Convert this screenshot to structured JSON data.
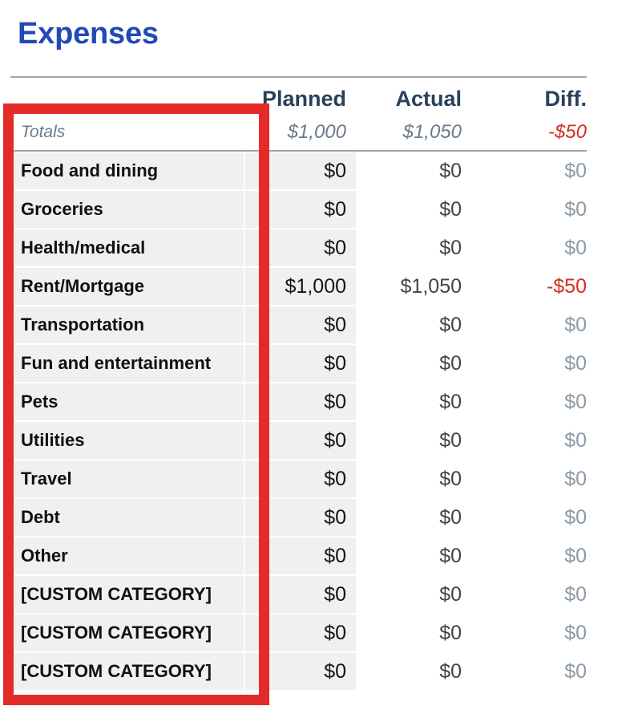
{
  "header": {
    "title": "Expenses"
  },
  "table": {
    "columns": [
      {
        "key": "category",
        "label": ""
      },
      {
        "key": "planned",
        "label": "Planned"
      },
      {
        "key": "actual",
        "label": "Actual"
      },
      {
        "key": "diff",
        "label": "Diff."
      }
    ],
    "totals": {
      "label": "Totals",
      "planned": "$1,000",
      "actual": "$1,050",
      "diff": "-$50",
      "diff_negative": true
    },
    "rows": [
      {
        "category": "Food and dining",
        "planned": "$0",
        "actual": "$0",
        "diff": "$0",
        "diff_negative": false
      },
      {
        "category": "Groceries",
        "planned": "$0",
        "actual": "$0",
        "diff": "$0",
        "diff_negative": false
      },
      {
        "category": "Health/medical",
        "planned": "$0",
        "actual": "$0",
        "diff": "$0",
        "diff_negative": false
      },
      {
        "category": "Rent/Mortgage",
        "planned": "$1,000",
        "actual": "$1,050",
        "diff": "-$50",
        "diff_negative": true
      },
      {
        "category": "Transportation",
        "planned": "$0",
        "actual": "$0",
        "diff": "$0",
        "diff_negative": false
      },
      {
        "category": "Fun and entertainment",
        "planned": "$0",
        "actual": "$0",
        "diff": "$0",
        "diff_negative": false
      },
      {
        "category": "Pets",
        "planned": "$0",
        "actual": "$0",
        "diff": "$0",
        "diff_negative": false
      },
      {
        "category": "Utilities",
        "planned": "$0",
        "actual": "$0",
        "diff": "$0",
        "diff_negative": false
      },
      {
        "category": "Travel",
        "planned": "$0",
        "actual": "$0",
        "diff": "$0",
        "diff_negative": false
      },
      {
        "category": "Debt",
        "planned": "$0",
        "actual": "$0",
        "diff": "$0",
        "diff_negative": false
      },
      {
        "category": "Other",
        "planned": "$0",
        "actual": "$0",
        "diff": "$0",
        "diff_negative": false
      },
      {
        "category": "[CUSTOM CATEGORY]",
        "planned": "$0",
        "actual": "$0",
        "diff": "$0",
        "diff_negative": false
      },
      {
        "category": "[CUSTOM CATEGORY]",
        "planned": "$0",
        "actual": "$0",
        "diff": "$0",
        "diff_negative": false
      },
      {
        "category": "[CUSTOM CATEGORY]",
        "planned": "$0",
        "actual": "$0",
        "diff": "$0",
        "diff_negative": false
      }
    ]
  },
  "annotation": {
    "highlight_color": "#e32b28",
    "target": "category-column"
  },
  "colors": {
    "title": "#2149b8",
    "header_text": "#29405b",
    "totals_text": "#6b7b8c",
    "negative": "#d62d20",
    "diff_zero": "#8b9aa8",
    "row_shade": "#f0f0f0",
    "rule": "#9aa7b5"
  }
}
